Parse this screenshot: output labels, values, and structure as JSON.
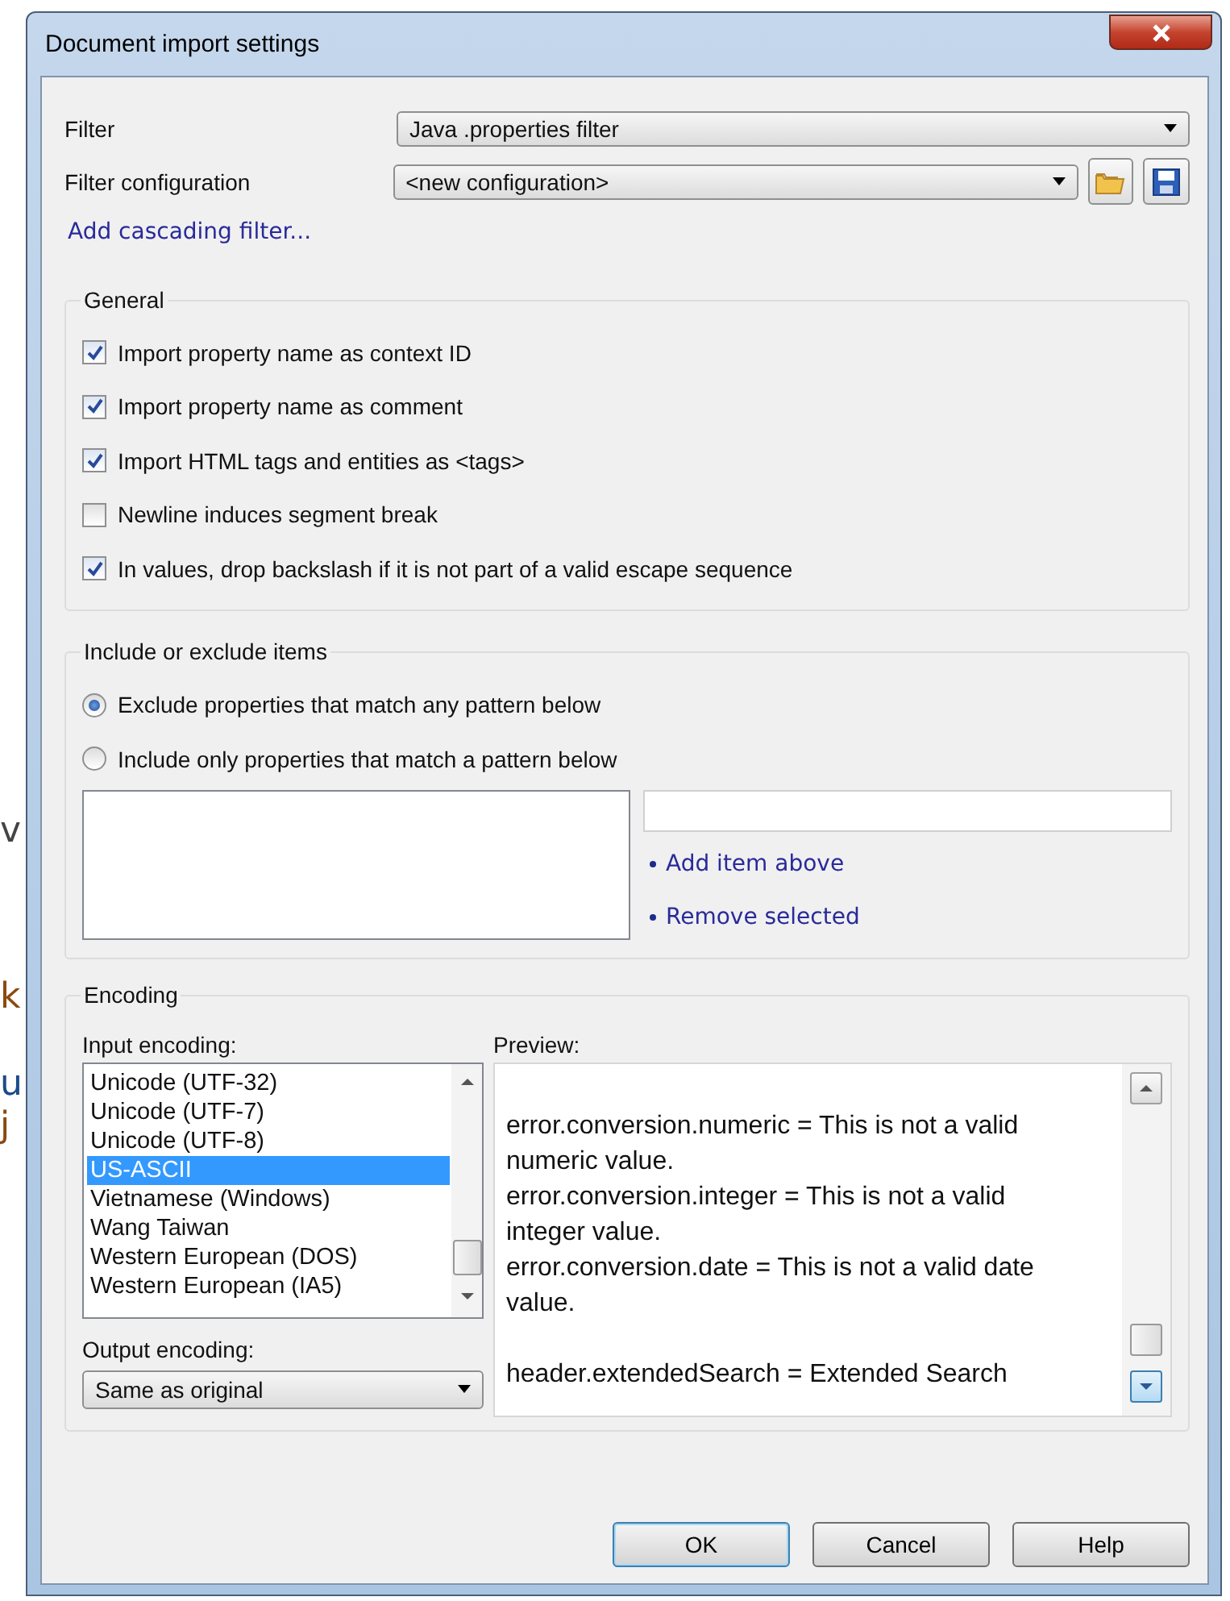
{
  "background_letters": [
    "v",
    "k",
    "u",
    "j"
  ],
  "window": {
    "title": "Document import settings"
  },
  "filter": {
    "label": "Filter",
    "value": "Java .properties filter"
  },
  "filter_configuration": {
    "label": "Filter configuration",
    "value": "<new configuration>"
  },
  "add_cascading_filter": "Add cascading filter...",
  "general": {
    "title": "General",
    "options": [
      {
        "label": "Import property name as context ID",
        "checked": true
      },
      {
        "label": "Import property name as comment",
        "checked": true
      },
      {
        "label": "Import HTML tags and entities as <tags>",
        "checked": true
      },
      {
        "label": "Newline induces segment break",
        "checked": false
      },
      {
        "label": "In values, drop backslash if it is not part of a valid escape sequence",
        "checked": true
      }
    ]
  },
  "include_exclude": {
    "title": "Include or exclude items",
    "modes": [
      {
        "label": "Exclude properties that match any pattern below",
        "selected": true
      },
      {
        "label": "Include only properties that match a pattern below",
        "selected": false
      }
    ],
    "links": [
      "Add item above",
      "Remove selected"
    ]
  },
  "encoding": {
    "title": "Encoding",
    "input_label": "Input encoding:",
    "input_items": [
      {
        "label": "Unicode (UTF-32)",
        "selected": false
      },
      {
        "label": "Unicode (UTF-7)",
        "selected": false
      },
      {
        "label": "Unicode (UTF-8)",
        "selected": false
      },
      {
        "label": "US-ASCII",
        "selected": true
      },
      {
        "label": "Vietnamese (Windows)",
        "selected": false
      },
      {
        "label": "Wang Taiwan",
        "selected": false
      },
      {
        "label": "Western European (DOS)",
        "selected": false
      },
      {
        "label": "Western European (IA5)",
        "selected": false
      }
    ],
    "output_label": "Output encoding:",
    "output_value": "Same as original",
    "preview_label": "Preview:",
    "preview_lines": [
      {
        "kind": "blank"
      },
      {
        "kind": "line",
        "text": "error.conversion.numeric = This is not a valid numeric value."
      },
      {
        "kind": "line",
        "text": "error.conversion.integer = This is not a valid integer value."
      },
      {
        "kind": "line",
        "text": "error.conversion.date = This is not a valid date value."
      },
      {
        "kind": "blank"
      },
      {
        "kind": "line",
        "text": "header.extendedSearch = Extended Search"
      }
    ]
  },
  "buttons": [
    {
      "label": "OK",
      "default": true
    },
    {
      "label": "Cancel",
      "default": false
    },
    {
      "label": "Help",
      "default": false
    }
  ]
}
